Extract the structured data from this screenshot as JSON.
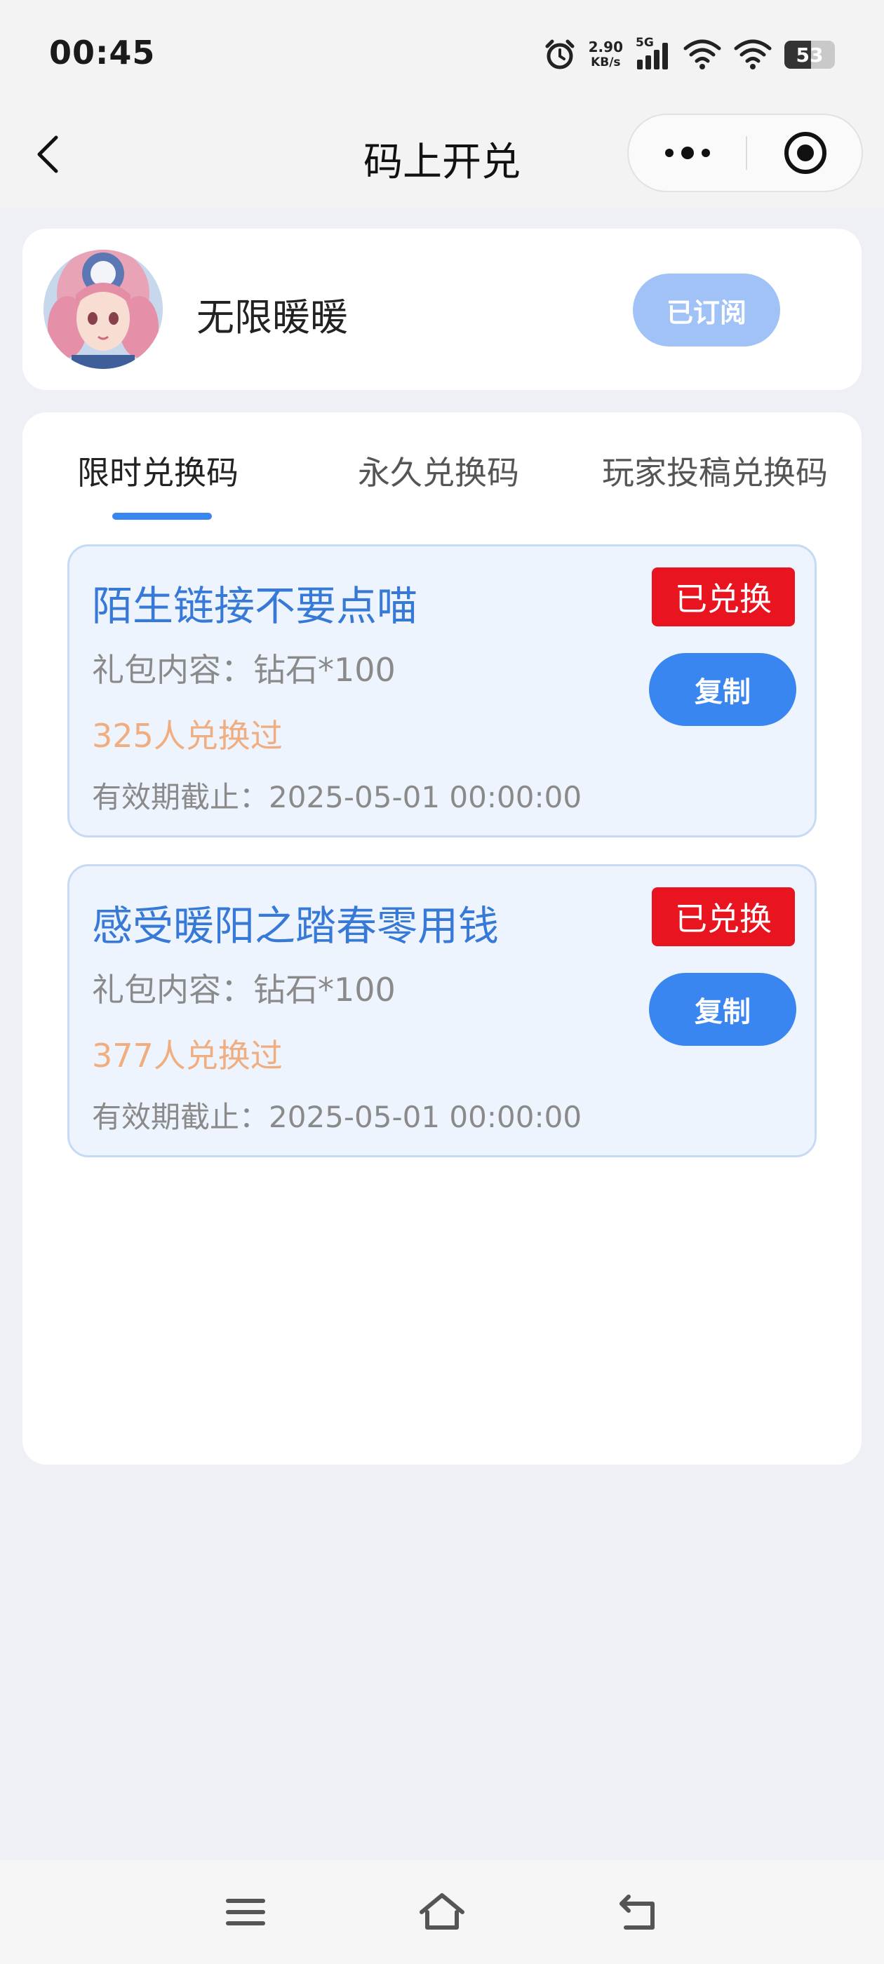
{
  "status_bar": {
    "time": "00:45",
    "net_speed_value": "2.90",
    "net_speed_unit": "KB/s",
    "signal_label": "5G",
    "battery_level": "53",
    "icons": [
      "alarm-icon",
      "signal-5g-icon",
      "wifi-icon",
      "wifi-icon",
      "battery-icon"
    ]
  },
  "nav": {
    "title": "码上开兑",
    "back_icon": "chevron-left-icon",
    "more_icon": "more-dots-icon",
    "close_icon": "target-circle-icon"
  },
  "profile": {
    "name": "无限暖暖",
    "subscribe_label": "已订阅",
    "subscribe_color": "#a0c2f6"
  },
  "tabs": [
    {
      "label": "限时兑换码",
      "active": true
    },
    {
      "label": "永久兑换码",
      "active": false
    },
    {
      "label": "玩家投稿兑换码",
      "active": false
    }
  ],
  "codes": [
    {
      "title": "陌生链接不要点喵",
      "gift": "礼包内容：钻石*100",
      "count": "325人兑换过",
      "expiry": "有效期截止：2025-05-01 00:00:00",
      "status": "已兑换",
      "copy_label": "复制"
    },
    {
      "title": "感受暖阳之踏春零用钱",
      "gift": "礼包内容：钻石*100",
      "count": "377人兑换过",
      "expiry": "有效期截止：2025-05-01 00:00:00",
      "status": "已兑换",
      "copy_label": "复制"
    }
  ],
  "colors": {
    "accent": "#3a86f0",
    "title_blue": "#3679d6",
    "count_orange": "#f0ad7f",
    "badge_red": "#e8141f",
    "card_bg": "#eef4fe",
    "page_bg": "#eef0f5"
  },
  "system_nav": {
    "icons": [
      "menu-icon",
      "home-icon",
      "back-icon"
    ]
  }
}
